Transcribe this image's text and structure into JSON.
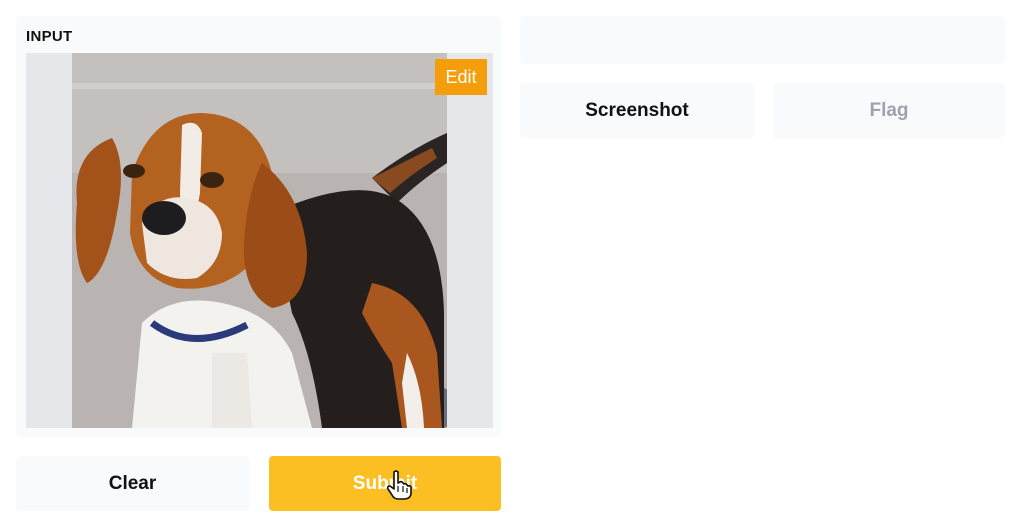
{
  "input": {
    "label": "INPUT",
    "image_alt": "beagle-dog-photo",
    "edit_label": "Edit"
  },
  "actions": {
    "clear_label": "Clear",
    "submit_label": "Submit"
  },
  "output": {
    "screenshot_label": "Screenshot",
    "flag_label": "Flag"
  },
  "colors": {
    "accent": "#fbbf24",
    "edit": "#f59e0b",
    "panel": "#f9fafb",
    "disabled_text": "#9ca3af"
  },
  "icons": {
    "cursor": "hand-pointer-icon"
  }
}
